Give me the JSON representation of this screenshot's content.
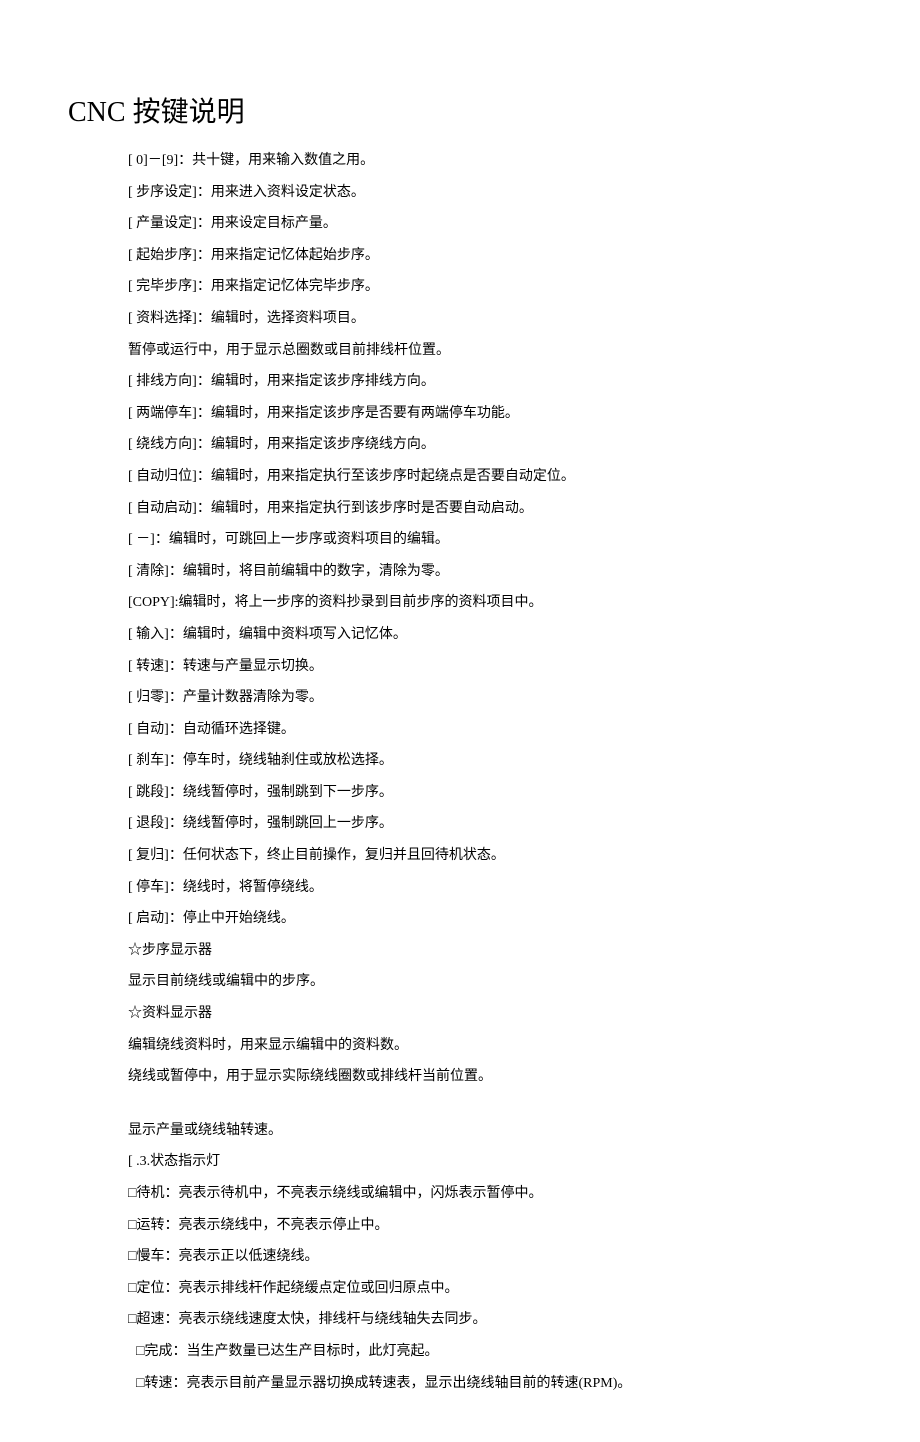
{
  "title": "CNC 按键说明",
  "lines": [
    "[ 0]－[9]：共十键，用来输入数值之用。",
    "[ 步序设定]：用来进入资料设定状态。",
    "[ 产量设定]：用来设定目标产量。",
    "[ 起始步序]：用来指定记忆体起始步序。",
    "[ 完毕步序]：用来指定记忆体完毕步序。",
    "[ 资料选择]：编辑时，选择资料项目。",
    "暂停或运行中，用于显示总圈数或目前排线杆位置。",
    "[ 排线方向]：编辑时，用来指定该步序排线方向。",
    "[ 两端停车]：编辑时，用来指定该步序是否要有两端停车功能。",
    "[ 绕线方向]：编辑时，用来指定该步序绕线方向。",
    "[ 自动归位]：编辑时，用来指定执行至该步序时起绕点是否要自动定位。",
    "[ 自动启动]：编辑时，用来指定执行到该步序时是否要自动启动。",
    "[ －]：编辑时，可跳回上一步序或资料项目的编辑。",
    "[ 清除]：编辑时，将目前编辑中的数字，清除为零。",
    "[COPY]:编辑时，将上一步序的资料抄录到目前步序的资料项目中。",
    "[ 输入]：编辑时，编辑中资料项写入记忆体。",
    "[ 转速]：转速与产量显示切换。",
    "[ 归零]：产量计数器清除为零。",
    "[ 自动]：自动循环选择键。",
    "[ 刹车]：停车时，绕线轴刹住或放松选择。",
    "[ 跳段]：绕线暂停时，强制跳到下一步序。",
    "[ 退段]：绕线暂停时，强制跳回上一步序。",
    "[ 复归]：任何状态下，终止目前操作，复归并且回待机状态。",
    "[ 停车]：绕线时，将暂停绕线。",
    "[ 启动]：停止中开始绕线。",
    "☆步序显示器",
    "显示目前绕线或编辑中的步序。",
    "☆资料显示器",
    "编辑绕线资料时，用来显示编辑中的资料数。",
    "绕线或暂停中，用于显示实际绕线圈数或排线杆当前位置。"
  ],
  "lines2": [
    "显示产量或绕线轴转速。",
    "[ .3.状态指示灯",
    "□待机：亮表示待机中，不亮表示绕线或编辑中，闪烁表示暂停中。",
    "□运转：亮表示绕线中，不亮表示停止中。",
    "□慢车：亮表示正以低速绕线。",
    "□定位：亮表示排线杆作起绕缓点定位或回归原点中。",
    "□超速：亮表示绕线速度太快，排线杆与绕线轴失去同步。"
  ],
  "lines3": [
    "□完成：当生产数量已达生产目标时，此灯亮起。",
    "□转速：亮表示目前产量显示器切换成转速表，显示出绕线轴目前的转速(RPM)。"
  ]
}
